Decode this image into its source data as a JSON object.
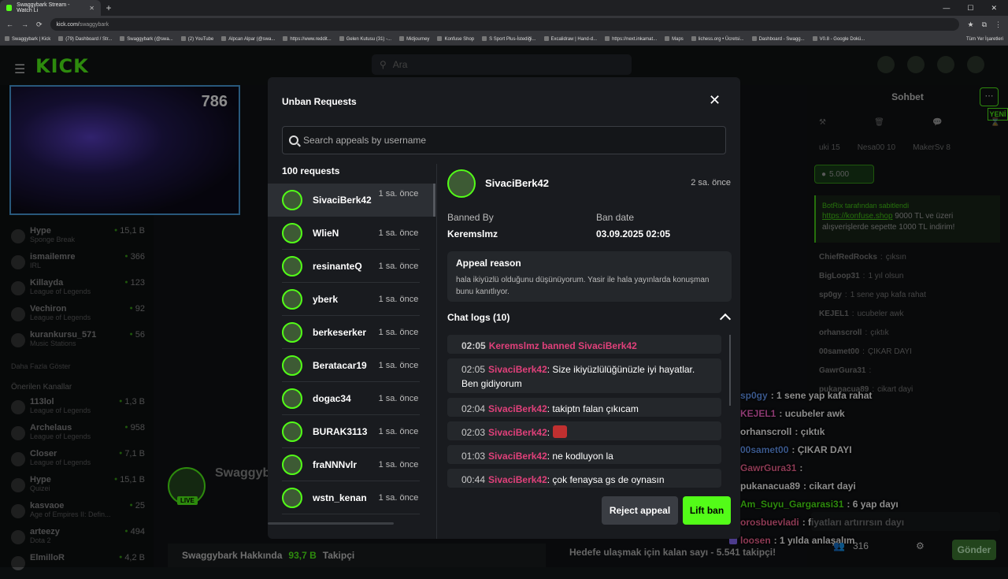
{
  "browser": {
    "tab_title": "Swaggybark Stream - Watch Li",
    "new_tab": "+",
    "url_host": "kick.com/",
    "url_path": "swaggybark",
    "bookmarks": [
      "Swaggybark | Kick",
      "(79) Dashboard / Str...",
      "Swaggybark (@swa...",
      "(2) YouTube",
      "Alpcan Alpar (@swa...",
      "https://www.reddit...",
      "Gelen Kutusu (31) -...",
      "Midjourney",
      "Konfuse Shop",
      "S Sport Plus-İstediği...",
      "Excalidraw | Hand-d...",
      "https://next.inkamat...",
      "Maps",
      "lichess.org • Ücretsi...",
      "Dashboard - Swagg...",
      "V0.8 - Google Dokü..."
    ],
    "bookmarks_right": "Tüm Yer İşaretleri"
  },
  "kick": {
    "logo": "KICK",
    "search_placeholder": "Ara"
  },
  "webcam": {
    "counter": "786"
  },
  "sidebar": {
    "followed": [
      {
        "name": "Hype",
        "sub": "Sponge Break",
        "viewers": "15,1 B"
      },
      {
        "name": "ismailemre",
        "sub": "IRL",
        "viewers": "366"
      },
      {
        "name": "Killayda",
        "sub": "League of Legends",
        "viewers": "123"
      },
      {
        "name": "Vechiron",
        "sub": "League of Legends",
        "viewers": "92"
      },
      {
        "name": "kurankursu_571",
        "sub": "Music Stations",
        "viewers": "56"
      }
    ],
    "show_more": "Daha Fazla Göster",
    "recommended_title": "Önerilen Kanallar",
    "recommended": [
      {
        "name": "113lol",
        "sub": "League of Legends",
        "viewers": "1,3 B"
      },
      {
        "name": "Archelaus",
        "sub": "League of Legends",
        "viewers": "958"
      },
      {
        "name": "Closer",
        "sub": "League of Legends",
        "viewers": "7,1 B"
      },
      {
        "name": "Hype",
        "sub": "Quizei",
        "viewers": "15,1 B"
      },
      {
        "name": "kasvaoe",
        "sub": "Age of Empires II: Defin...",
        "viewers": "25"
      },
      {
        "name": "arteezy",
        "sub": "Dota 2",
        "viewers": "494"
      },
      {
        "name": "ElmilloR",
        "sub": "",
        "viewers": "4,2 B"
      }
    ]
  },
  "stream": {
    "streamer": "Swaggyb",
    "live_badge": "LIVE",
    "about": "Swaggybark Hakkında",
    "followers": "93,7 B",
    "followers_label": "Takipçi",
    "goal": "Hedefe ulaşmak için kalan sayı - 5.541 takipçi!"
  },
  "chat": {
    "title": "Sohbet",
    "new_label": "YENİ",
    "leaders": [
      {
        "name": "uki",
        "count": "15"
      },
      {
        "name": "Nesa00",
        "count": "10"
      },
      {
        "name": "MakerSv",
        "count": "8"
      }
    ],
    "gift_amount": "5.000",
    "pinned_by": "BotRix tarafından sabitlendi",
    "pinned_link": "https://konfuse.shop",
    "pinned_text": "9000 TL ve üzeri alışverişlerde sepette 1000 TL indirim!",
    "old_messages": [
      {
        "user": "ChiefRedRocks",
        "text": "çıksın"
      },
      {
        "user": "BigLoop31",
        "text": "1 yıl olsun"
      },
      {
        "user": "sp0gy",
        "text": "1 sene yap kafa rahat"
      },
      {
        "user": "KEJEL1",
        "text": "ucubeler awk"
      },
      {
        "user": "orhanscroll",
        "text": "çıktık"
      },
      {
        "user": "00samet00",
        "text": "ÇIKAR DAYI"
      },
      {
        "user": "GawrGura31",
        "text": ""
      },
      {
        "user": "pukanacua89",
        "text": "cikart dayi"
      }
    ],
    "overlay_messages": [
      {
        "user": "sp0gy",
        "text": ": 1 sene yap kafa rahat",
        "color": "#6aa0ff"
      },
      {
        "user": "KEJEL1",
        "text": ": ucubeler awk",
        "color": "#ff6ad0"
      },
      {
        "user": "orhanscroll",
        "text": ": çıktık",
        "color": "#ffffff"
      },
      {
        "user": "00samet00",
        "text": ": ÇIKAR DAYI",
        "color": "#6aa0ff"
      },
      {
        "user": "GawrGura31",
        "text": ":",
        "color": "#ff6a9a"
      },
      {
        "user": "pukanacua89",
        "text": ": cikart dayi",
        "color": "#ffffff"
      },
      {
        "user": "Am_Suyu_Gargarasi31",
        "text": ": 6 yap dayı",
        "color": "#53fc18"
      },
      {
        "user": "orosbuevladi",
        "text": ": fiyatları artırırsın dayı",
        "color": "#ff6a9a"
      },
      {
        "user": "loosen",
        "text": ": 1 yılda anlaşalım",
        "color": "#ff6a9a"
      }
    ],
    "viewer_count": "316",
    "send": "Gönder"
  },
  "modal": {
    "title": "Unban Requests",
    "search_placeholder": "Search appeals by username",
    "count": "100 requests",
    "requests": [
      {
        "user": "SivaciBerk42",
        "time": "1 sa. önce"
      },
      {
        "user": "WlieN",
        "time": "1 sa. önce"
      },
      {
        "user": "resinanteQ",
        "time": "1 sa. önce"
      },
      {
        "user": "yberk",
        "time": "1 sa. önce"
      },
      {
        "user": "berkeserker",
        "time": "1 sa. önce"
      },
      {
        "user": "Beratacar19",
        "time": "1 sa. önce"
      },
      {
        "user": "dogac34",
        "time": "1 sa. önce"
      },
      {
        "user": "BURAK3113",
        "time": "1 sa. önce"
      },
      {
        "user": "fraNNNvlr",
        "time": "1 sa. önce"
      },
      {
        "user": "wstn_kenan",
        "time": "1 sa. önce"
      }
    ],
    "detail": {
      "user": "SivaciBerk42",
      "time": "2 sa. önce",
      "banned_by_label": "Banned By",
      "banned_by": "Keremslmz",
      "ban_date_label": "Ban date",
      "ban_date": "03.09.2025 02:05",
      "reason_title": "Appeal reason",
      "reason": "hala ikiyüzlü olduğunu düşünüyorum. Yasir ile hala yayınlarda konuşman bunu kanıtlıyor.",
      "logs_title": "Chat logs (10)",
      "logs": [
        {
          "time": "02:05",
          "user": "",
          "text": "Keremslmz banned SivaciBerk42"
        },
        {
          "time": "02:05",
          "user": "SivaciBerk42",
          "text": ": Size ikiyüzlülüğünüzle iyi hayatlar. Ben gidiyorum"
        },
        {
          "time": "02:04",
          "user": "SivaciBerk42",
          "text": ": takiptn falan çıkıcam"
        },
        {
          "time": "02:03",
          "user": "SivaciBerk42",
          "text": ":"
        },
        {
          "time": "01:03",
          "user": "SivaciBerk42",
          "text": ": ne kodluyon la"
        },
        {
          "time": "00:44",
          "user": "SivaciBerk42",
          "text": ": çok fenaysa gs de oynasın"
        }
      ]
    },
    "reject": "Reject appeal",
    "lift": "Lift ban"
  }
}
